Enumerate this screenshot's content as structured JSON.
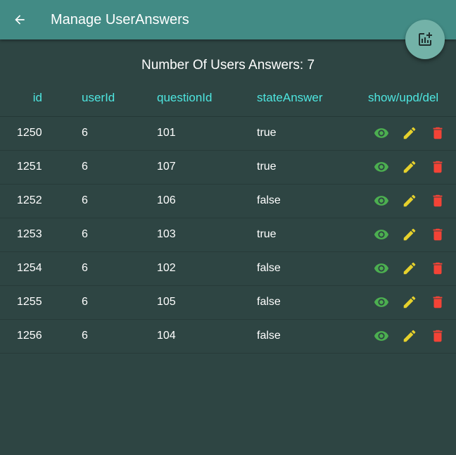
{
  "appbar": {
    "title": "Manage UserAnswers",
    "color": "#428b85"
  },
  "summary": {
    "label": "Number Of Users Answers:",
    "count": "7"
  },
  "table": {
    "headers": {
      "id": "id",
      "userId": "userId",
      "questionId": "questionId",
      "stateAnswer": "stateAnswer",
      "actions": "show/upd/del"
    },
    "rows": [
      {
        "id": "1250",
        "userId": "6",
        "questionId": "101",
        "stateAnswer": "true"
      },
      {
        "id": "1251",
        "userId": "6",
        "questionId": "107",
        "stateAnswer": "true"
      },
      {
        "id": "1252",
        "userId": "6",
        "questionId": "106",
        "stateAnswer": "false"
      },
      {
        "id": "1253",
        "userId": "6",
        "questionId": "103",
        "stateAnswer": "true"
      },
      {
        "id": "1254",
        "userId": "6",
        "questionId": "102",
        "stateAnswer": "false"
      },
      {
        "id": "1255",
        "userId": "6",
        "questionId": "105",
        "stateAnswer": "false"
      },
      {
        "id": "1256",
        "userId": "6",
        "questionId": "104",
        "stateAnswer": "false"
      }
    ]
  },
  "icons": {
    "back": "arrow-back-icon",
    "fab": "add-chart-icon",
    "show": "eye-icon",
    "update": "pencil-icon",
    "delete": "trash-icon"
  },
  "colors": {
    "background": "#2e4543",
    "header_text": "#4ee6e0",
    "show": "#4caf50",
    "update": "#e6d12c",
    "delete": "#f44336",
    "fab": "#73b2a8"
  }
}
